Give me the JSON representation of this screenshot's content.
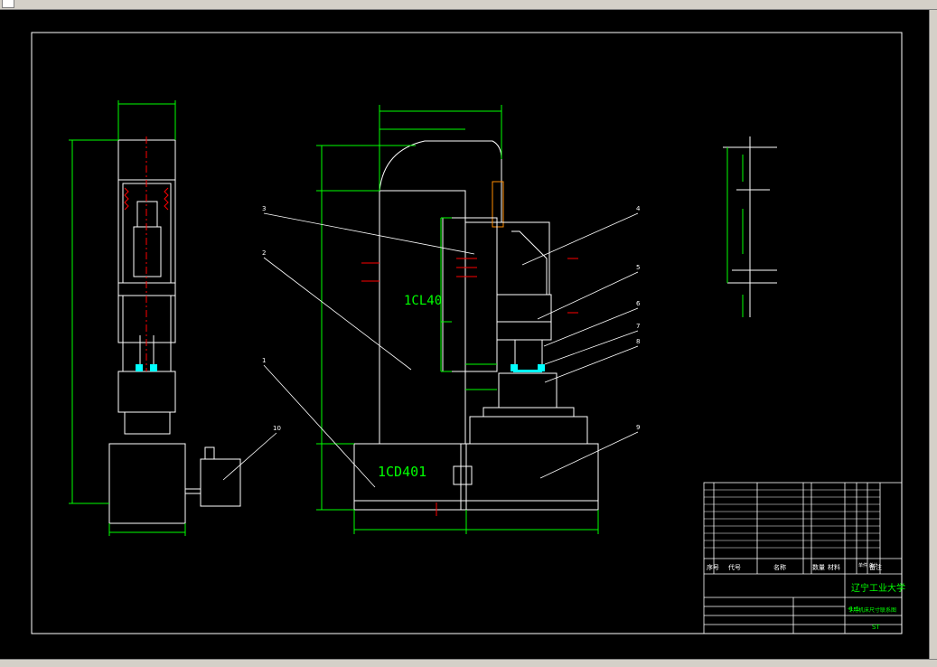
{
  "window": {
    "tab_label": ""
  },
  "labels": {
    "column_text": "1CL40",
    "base_text": "1CD401",
    "school": "辽宁工业大学",
    "drawing_title": "专用机床尺寸联系图"
  },
  "callouts": [
    "1",
    "2",
    "3",
    "4",
    "5",
    "6",
    "7",
    "8",
    "9",
    "10"
  ],
  "title_block": {
    "header_seq": "序号",
    "header_code": "代号",
    "header_name": "名称",
    "header_qty": "数量",
    "header_material": "材料",
    "header_weight": "单件 总计",
    "header_remark": "备注",
    "scale": "1:1",
    "sheet_code": "ST"
  },
  "colors": {
    "outline": "#ffffff",
    "dimension": "#00ff00",
    "center": "#ff0000",
    "highlight": "#00ffff",
    "title_text": "#00ff00"
  }
}
